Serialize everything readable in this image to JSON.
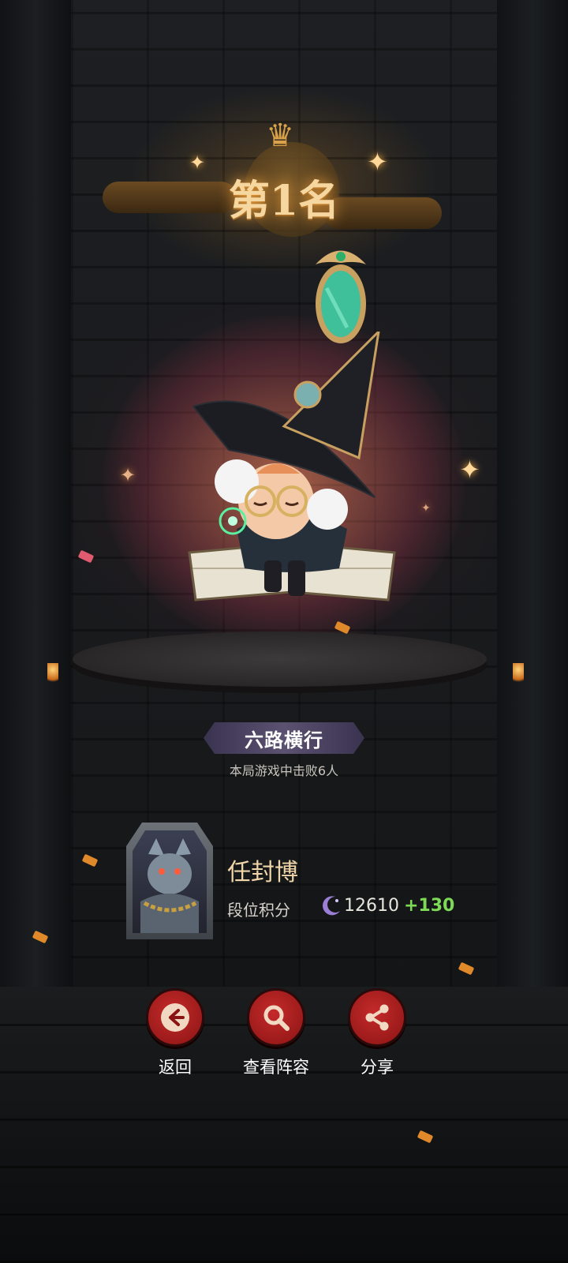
{
  "result": {
    "rank_title": "第1名"
  },
  "achievement": {
    "title": "六路横行",
    "description": "本局游戏中击败6人"
  },
  "player": {
    "name": "任封博",
    "rank_label": "段位积分",
    "score": "12610",
    "score_delta": "+130"
  },
  "actions": [
    {
      "label": "返回",
      "icon": "back-arrow-icon"
    },
    {
      "label": "查看阵容",
      "icon": "magnifier-icon"
    },
    {
      "label": "分享",
      "icon": "share-icon"
    }
  ],
  "colors": {
    "button_red": "#c52a2a",
    "title_gold": "#f7d7a0",
    "delta_green": "#7ed957"
  }
}
